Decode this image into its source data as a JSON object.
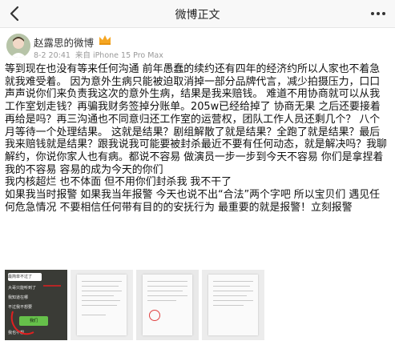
{
  "header": {
    "title": "微博正文"
  },
  "post": {
    "author": "赵露思的微博",
    "time": "8-2 20:41",
    "source": "来自 iPhone 15 Pro Max",
    "paragraphs": [
      "等到现在也没有等来任何沟通 前年愚蠢的续约还有四年的经济约所以人家也不着急 就我难受着。 因为意外生病只能被迫取消掉一部分品牌代言，减少拍摄压力，口口声声说你们来负责我这次的意外生病，结果是我来赔钱。 难道不用协商就可以从我工作室划走钱？再骗我财务签掉分账单。205w已经给掉了 协商无果 之后还要接着再给是吗？再三沟通也不同意归还工作室的运营权，团队工作人员还剩几个？ 八个月等待一个处理结果。 这就是结果？剧组解散了就是结果？全跑了就是结果？最后我来赔钱就是结果？跟我说我可能要被封杀最近不要有任何动态，就是解决吗？我聊解约，你说你家人也有病。都说不容易 做演员一步一步到今天不容易 你们是拿捏着我的不容易 容易的成为今天的你们",
      "我内核超烂 也不体面 但不用你们封杀我 我不干了",
      "如果我当时报警 如果我当年报警 今天也说不出“合法”两个字吧 所以宝贝们 遇见任何危急情况 不要相信任何带有目的的安抚行为 最重要的就是报警！立刻报警"
    ],
    "images": [
      {
        "type": "chat-screenshot",
        "texts": [
          "最简单不过了",
          "大哥只能听到了",
          "我知道在哪",
          "不过我不想要",
          "我们",
          "我也不想",
          "毛躁咋了",
          "就是...",
          "脸色",
          "在..."
        ]
      },
      {
        "type": "document-photo",
        "texts": []
      },
      {
        "type": "document-photo",
        "texts": []
      },
      {
        "type": "document-photo",
        "texts": []
      }
    ]
  },
  "colors": {
    "text": "#111111",
    "meta": "#999999",
    "topbar": "#f8f8f8",
    "accent": "#f5a623"
  }
}
